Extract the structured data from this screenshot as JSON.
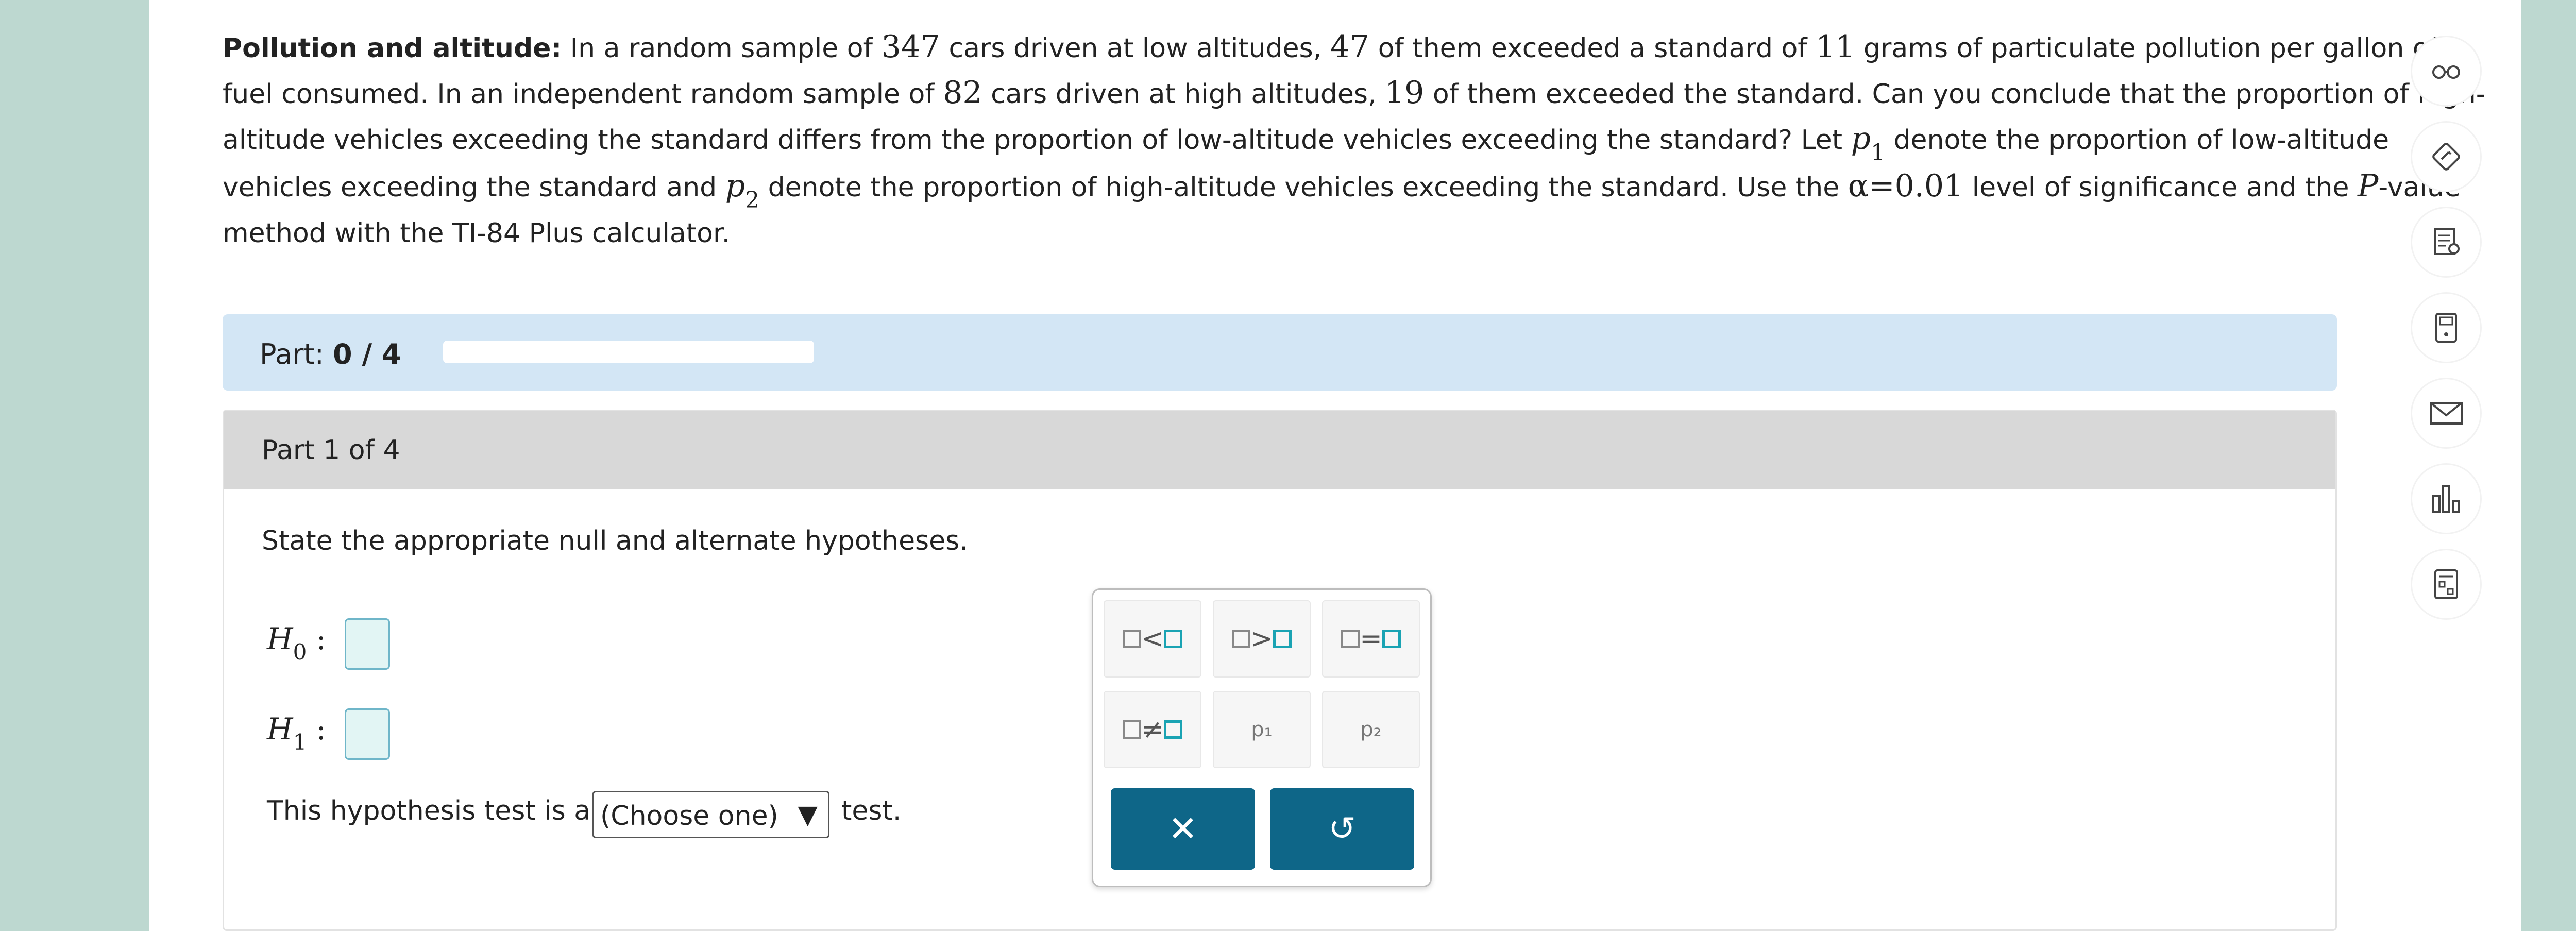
{
  "problem": {
    "title": "Pollution and altitude:",
    "s1": "In a random sample of",
    "n_low": "347",
    "s2": "cars driven at low altitudes,",
    "x_low": "47",
    "s3": "of them exceeded a standard of",
    "grams": "11",
    "s4": "grams of particulate pollution per gallon of fuel consumed. In an independent random sample of",
    "n_high": "82",
    "s5": "cars driven at high altitudes,",
    "x_high": "19",
    "s6": "of them exceeded the standard. Can you conclude that the proportion of high-altitude vehicles exceeding the standard differs from the proportion of low-altitude vehicles exceeding the standard? Let",
    "p": "p",
    "p1_sub": "1",
    "s7": "denote the proportion of low-altitude vehicles exceeding the standard and",
    "p2_sub": "2",
    "s8": "denote the proportion of high-altitude vehicles exceeding the standard. Use the",
    "alpha": "α=0.01",
    "s9": "level of significance and the",
    "P": "P",
    "s10": "-value method with the TI-84 Plus calculator."
  },
  "part_progress": {
    "label": "Part:",
    "value": "0 / 4",
    "fraction": 0
  },
  "part": {
    "header": "Part 1 of 4",
    "instruction": "State the appropriate null and alternate hypotheses.",
    "h0_letter": "H",
    "h0_sub": "0",
    "h1_letter": "H",
    "h1_sub": "1",
    "colon": ":",
    "test_prefix": "This hypothesis test is a",
    "select_value": "(Choose one)",
    "select_arrow": "▼",
    "test_suffix": "test."
  },
  "palette": {
    "keys": [
      {
        "id": "lt",
        "symbol": "<"
      },
      {
        "id": "gt",
        "symbol": ">"
      },
      {
        "id": "eq",
        "symbol": "="
      },
      {
        "id": "ne",
        "symbol": "≠"
      }
    ],
    "p1": "p₁",
    "p2": "p₂",
    "clear_symbol": "✕",
    "undo_symbol": "↺"
  },
  "sidebar": [
    "glasses-icon",
    "pencil-diamond-icon",
    "notes-bulb-icon",
    "calculator-icon",
    "mail-icon",
    "bar-chart-icon",
    "calculator-sheet-icon"
  ],
  "colors": {
    "accent": "#0e6688",
    "input_border": "#6fb6c9",
    "part_bar": "#d3e6f5",
    "background": "#bdd8d0"
  }
}
